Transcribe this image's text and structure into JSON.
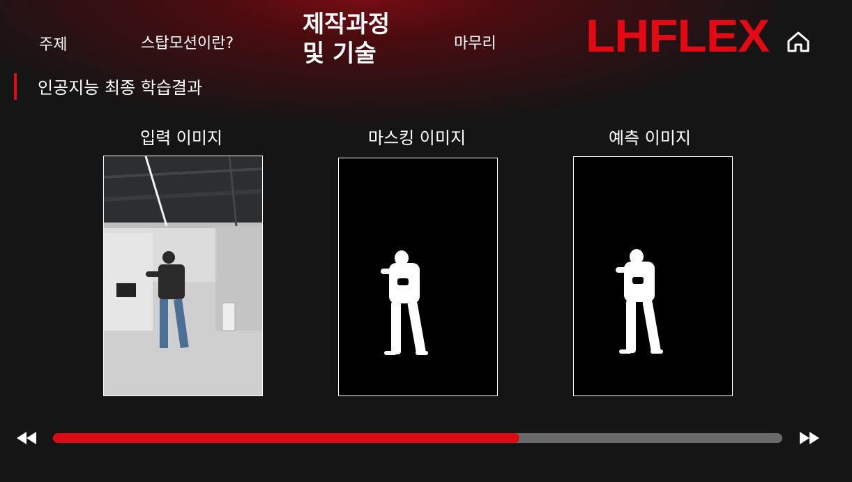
{
  "nav": {
    "topic": "주제",
    "stop_motion": "스탑모션이란?",
    "process": "제작과정\n및 기술",
    "conclusion": "마무리"
  },
  "brand": {
    "logo": "LHFLEX",
    "accent": "#e50914"
  },
  "icons": {
    "home": "home-icon",
    "rewind": "rewind-icon",
    "fast_forward": "fast-forward-icon"
  },
  "section": {
    "title": "인공지능 최종 학습결과"
  },
  "panels": [
    {
      "title": "입력 이미지",
      "kind": "photo"
    },
    {
      "title": "마스킹 이미지",
      "kind": "mask"
    },
    {
      "title": "예측 이미지",
      "kind": "mask"
    }
  ],
  "player": {
    "progress": 0.64
  }
}
